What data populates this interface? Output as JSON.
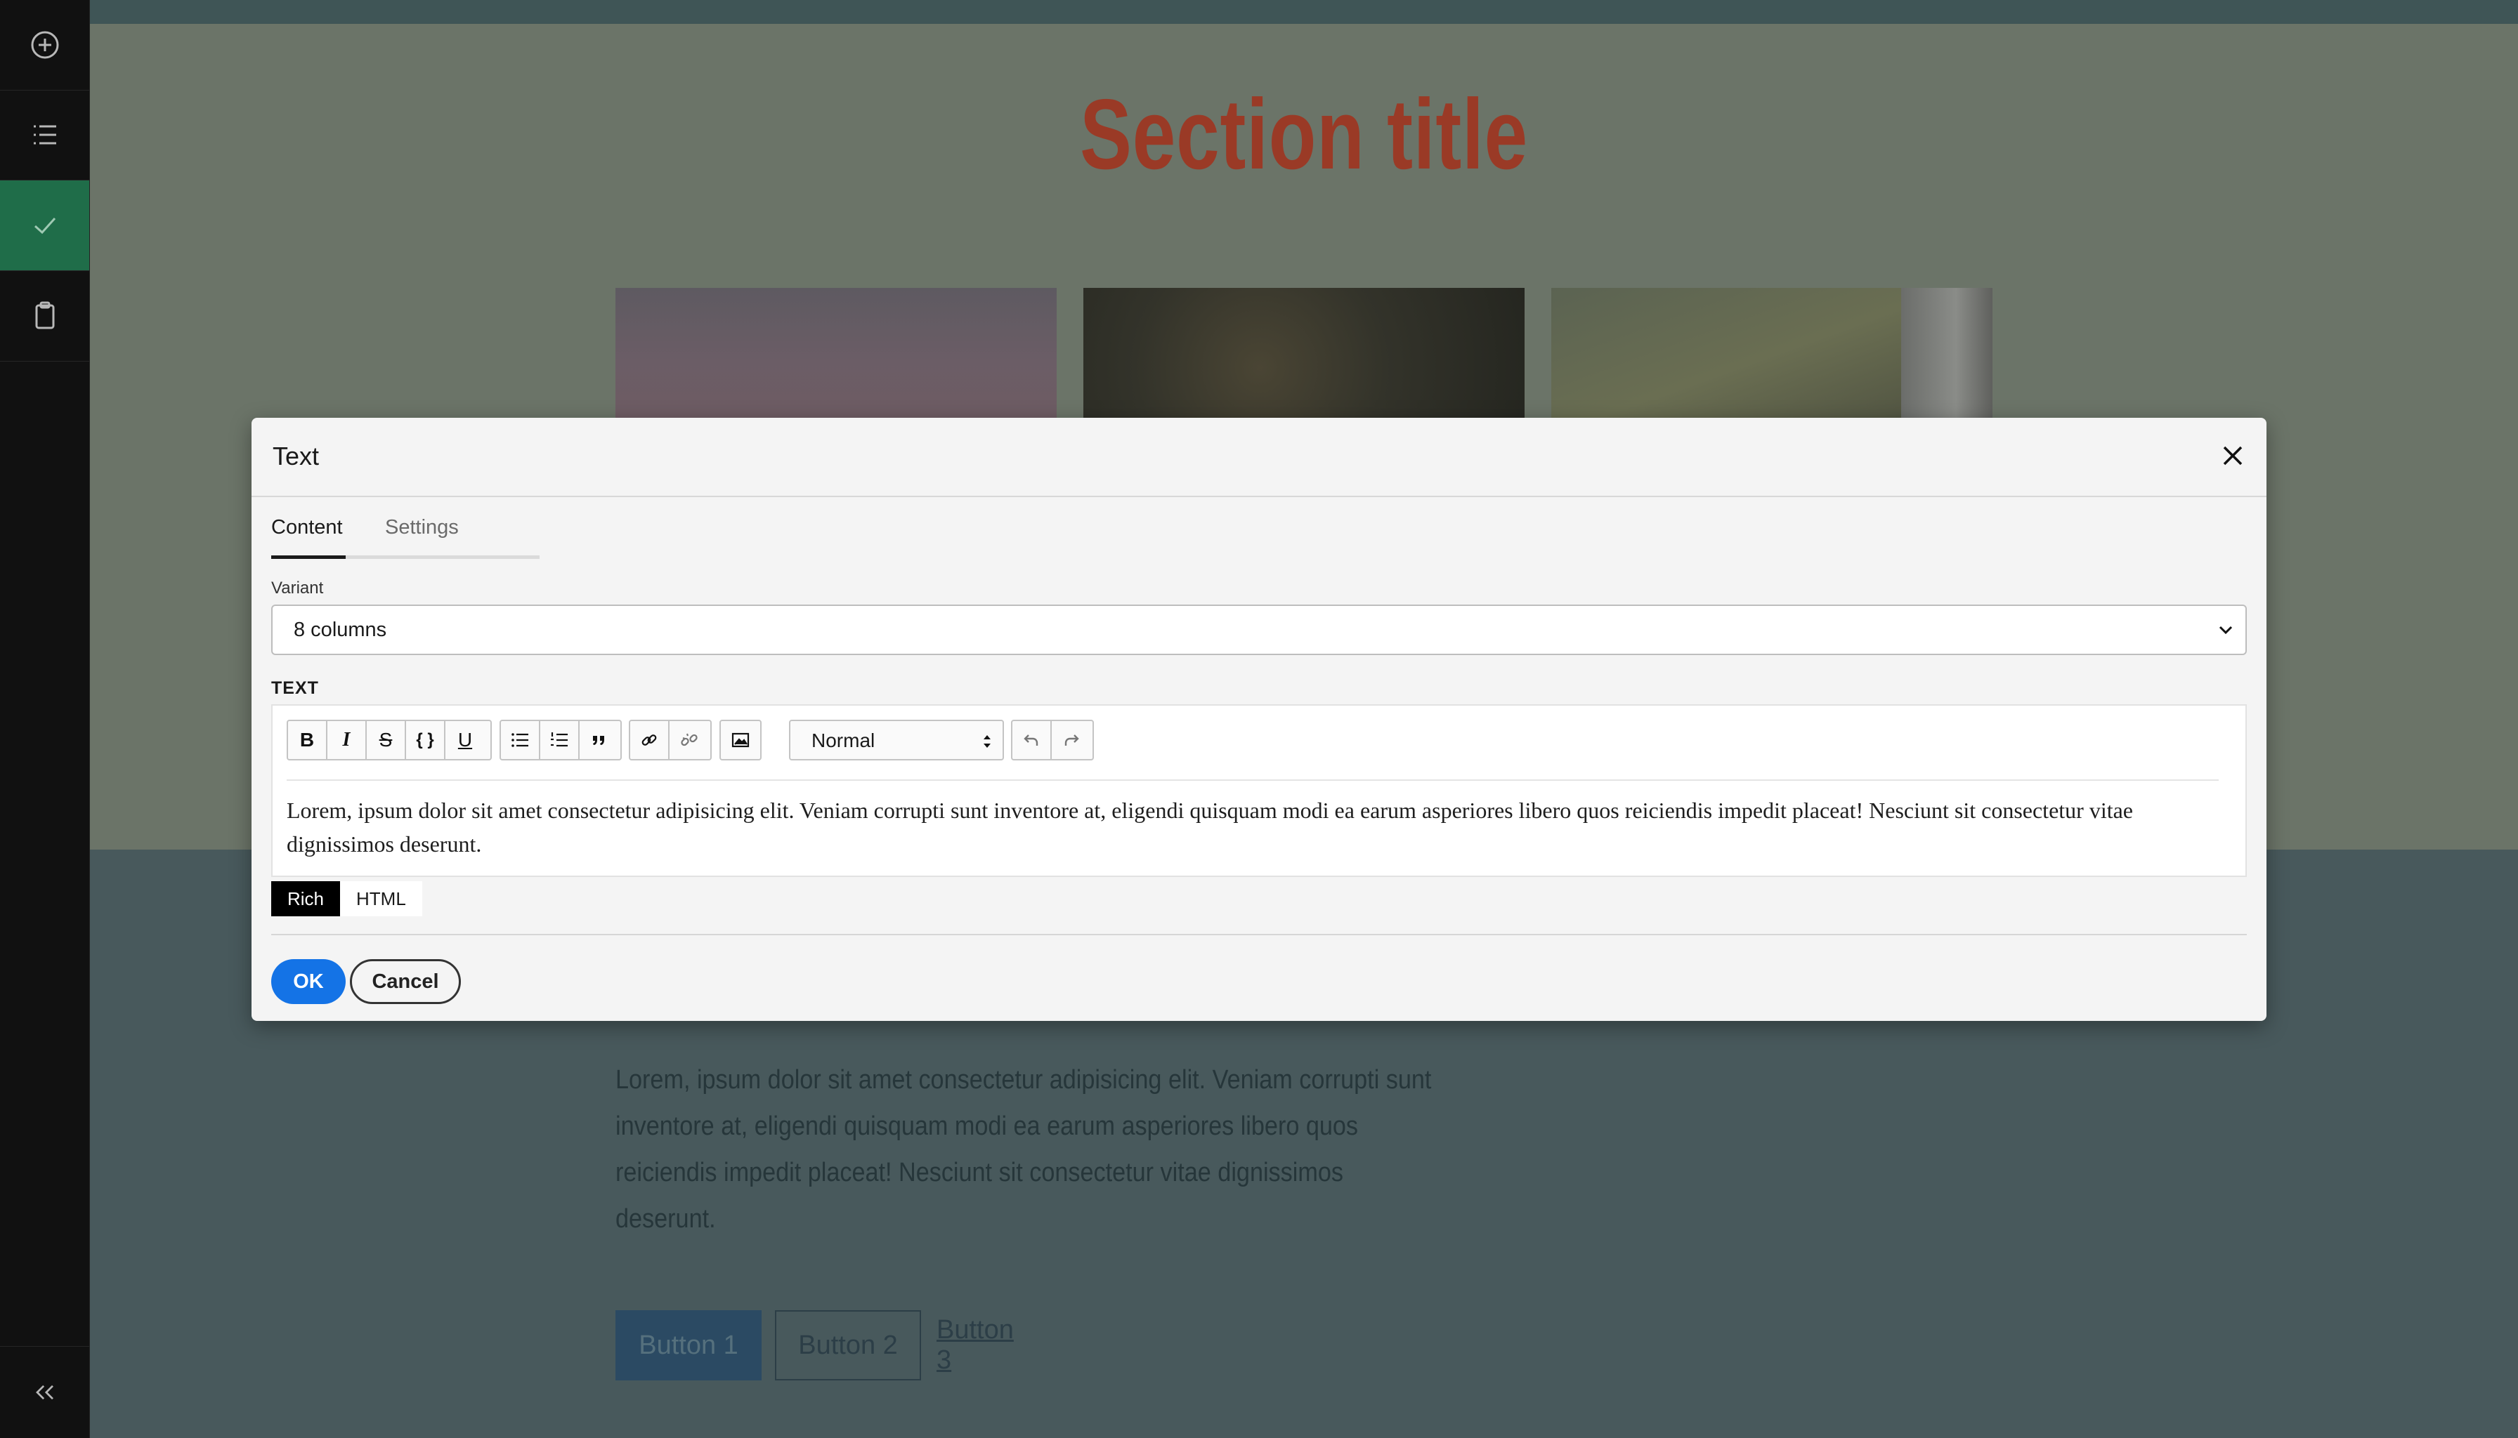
{
  "sidebar": {
    "items": [
      {
        "name": "add",
        "icon": "plus-circle-icon"
      },
      {
        "name": "list",
        "icon": "list-icon"
      },
      {
        "name": "check",
        "icon": "check-icon",
        "active": true
      },
      {
        "name": "clipboard",
        "icon": "clipboard-icon"
      }
    ],
    "collapse_icon": "double-chevron-left-icon",
    "active_color": "#1f6d49"
  },
  "page": {
    "section_title": "Section title",
    "body_text": "Lorem, ipsum dolor sit amet consectetur adipisicing elit. Veniam corrupti sunt inventore at, eligendi quisquam modi ea earum asperiores libero quos reiciendis impedit placeat! Nesciunt sit consectetur vitae dignissimos deserunt.",
    "buttons": [
      "Button 1",
      "Button 2",
      "Button 3"
    ],
    "title_color": "#9a3a26"
  },
  "modal": {
    "title": "Text",
    "tabs": [
      "Content",
      "Settings"
    ],
    "active_tab": "Content",
    "variant_label": "Variant",
    "variant_value": "8 columns",
    "text_label": "TEXT",
    "toolbar": {
      "bold": "B",
      "italic": "I",
      "strikethrough": "S",
      "code": "{ }",
      "underline": "U",
      "format_value": "Normal",
      "icons": [
        "bold-icon",
        "italic-icon",
        "strikethrough-icon",
        "code-icon",
        "underline-icon",
        "bullet-list-icon",
        "numbered-list-icon",
        "quote-icon",
        "link-icon",
        "unlink-icon",
        "image-icon",
        "undo-icon",
        "redo-icon"
      ]
    },
    "editor_text": "Lorem, ipsum dolor sit amet consectetur adipisicing elit. Veniam corrupti sunt inventore at, eligendi quisquam modi ea earum asperiores libero quos reiciendis impedit placeat! Nesciunt sit consectetur vitae dignissimos deserunt.",
    "modes": [
      "Rich",
      "HTML"
    ],
    "active_mode": "Rich",
    "ok_label": "OK",
    "cancel_label": "Cancel",
    "ok_color": "#1473e6"
  }
}
